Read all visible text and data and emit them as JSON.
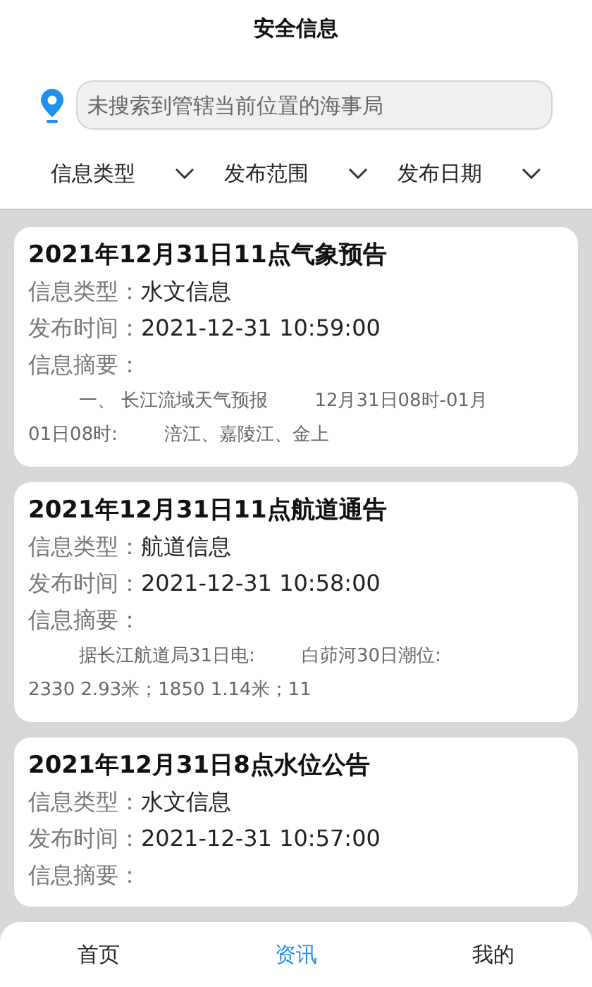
{
  "header": {
    "title": "安全信息"
  },
  "search": {
    "placeholder": "未搜索到管辖当前位置的海事局"
  },
  "filters": [
    {
      "label": "信息类型"
    },
    {
      "label": "发布范围"
    },
    {
      "label": "发布日期"
    }
  ],
  "cards": [
    {
      "title": "2021年12月31日11点气象预告",
      "type_label": "信息类型：",
      "type_value": "水文信息",
      "time_label": "发布时间：",
      "time_value": "2021-12-31 10:59:00",
      "summary_label": "信息摘要：",
      "summary_lines": [
        "一、 长江流域天气预报        12月31日08时-01月",
        "01日08时:        涪江、嘉陵江、金上"
      ]
    },
    {
      "title": "2021年12月31日11点航道通告",
      "type_label": "信息类型：",
      "type_value": "航道信息",
      "time_label": "发布时间：",
      "time_value": "2021-12-31 10:58:00",
      "summary_label": "信息摘要：",
      "summary_lines": [
        "据长江航道局31日电:        白茆河30日潮位:",
        "2330 2.93米；1850 1.14米；11"
      ]
    },
    {
      "title": "2021年12月31日8点水位公告",
      "type_label": "信息类型：",
      "type_value": "水文信息",
      "time_label": "发布时间：",
      "time_value": "2021-12-31 10:57:00",
      "summary_label": "信息摘要："
    }
  ],
  "tabs": [
    {
      "label": "首页",
      "selected": false
    },
    {
      "label": "资讯",
      "selected": true
    },
    {
      "label": "我的",
      "selected": false
    }
  ]
}
